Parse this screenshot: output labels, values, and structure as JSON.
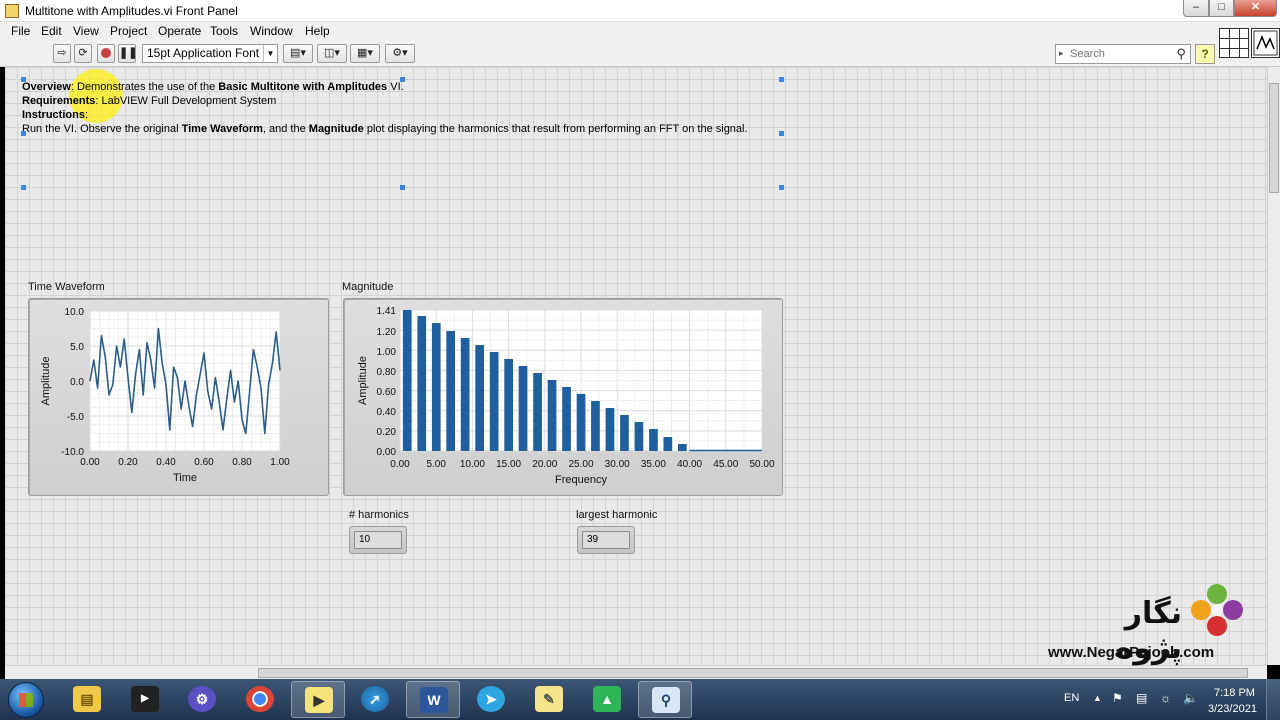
{
  "window": {
    "title": "Multitone with Amplitudes.vi Front Panel",
    "minimize": "–",
    "maximize": "□",
    "close": "✕"
  },
  "menu": [
    "File",
    "Edit",
    "View",
    "Project",
    "Operate",
    "Tools",
    "Window",
    "Help"
  ],
  "toolbar": {
    "font": "15pt Application Font",
    "search_placeholder": "Search",
    "help": "?"
  },
  "description": {
    "overview_label": "Overview",
    "overview_text": ": Demonstrates the use of the ",
    "overview_bold": "Basic Multitone with Amplitudes",
    "overview_end": " VI.",
    "requirements_label": "Requirements",
    "requirements_text": ": LabVIEW Full Development System",
    "instructions_label": "Instructions",
    "instructions_colon": ":",
    "run_1": "Run the VI. Observe the original ",
    "run_bold1": "Time Waveform",
    "run_2": ", and the ",
    "run_bold2": "Magnitude",
    "run_3": " plot displaying the harmonics that result from performing an FFT on the signal."
  },
  "indicators": {
    "harmonics_label": "# harmonics",
    "harmonics_value": "10",
    "largest_label": "largest harmonic",
    "largest_value": "39"
  },
  "watermark": {
    "brand_fa": "نگار پژوه",
    "url": "www.NegarPajooh.com"
  },
  "taskbar": {
    "language": "EN",
    "time": "7:18 PM",
    "date": "3/23/2021"
  },
  "colors": {
    "plot": "#2b5d8a",
    "bar": "#1f5f9e",
    "plot_bg": "#ffffff",
    "highlight": "#fff000"
  },
  "chart_data": [
    {
      "type": "line",
      "title": "Time Waveform",
      "xlabel": "Time",
      "ylabel": "Amplitude",
      "xlim": [
        0,
        1
      ],
      "ylim": [
        -10,
        10
      ],
      "xticks": [
        "0.00",
        "0.20",
        "0.40",
        "0.60",
        "0.80",
        "1.00"
      ],
      "yticks": [
        "10.0",
        "5.0",
        "0.0",
        "-5.0",
        "-10.0"
      ],
      "grid": true,
      "x": [
        0.0,
        0.02,
        0.04,
        0.06,
        0.08,
        0.1,
        0.12,
        0.14,
        0.16,
        0.18,
        0.2,
        0.22,
        0.24,
        0.26,
        0.28,
        0.3,
        0.32,
        0.34,
        0.36,
        0.38,
        0.4,
        0.42,
        0.44,
        0.46,
        0.48,
        0.5,
        0.52,
        0.54,
        0.56,
        0.58,
        0.6,
        0.62,
        0.64,
        0.66,
        0.68,
        0.7,
        0.72,
        0.74,
        0.76,
        0.78,
        0.8,
        0.82,
        0.84,
        0.86,
        0.88,
        0.9,
        0.92,
        0.94,
        0.96,
        0.98,
        1.0
      ],
      "y": [
        0.0,
        3.0,
        -1.0,
        6.5,
        3.5,
        -2.0,
        -0.5,
        5.0,
        2.0,
        6.0,
        0.5,
        -4.5,
        1.0,
        4.5,
        -2.0,
        5.5,
        3.0,
        -1.0,
        7.5,
        2.5,
        -0.5,
        -7.0,
        2.0,
        0.5,
        -4.0,
        0.0,
        -3.5,
        -6.5,
        -2.0,
        1.0,
        4.0,
        -1.5,
        -4.0,
        0.5,
        -3.0,
        -7.0,
        -2.5,
        1.5,
        -3.0,
        0.0,
        -5.5,
        -7.5,
        -1.5,
        4.5,
        2.0,
        -1.0,
        -7.5,
        -0.5,
        2.5,
        7.0,
        1.5
      ]
    },
    {
      "type": "bar",
      "title": "Magnitude",
      "xlabel": "Frequency",
      "ylabel": "Amplitude",
      "xlim": [
        0,
        50
      ],
      "ylim": [
        0,
        1.41
      ],
      "xticks": [
        "0.00",
        "5.00",
        "10.00",
        "15.00",
        "20.00",
        "25.00",
        "30.00",
        "35.00",
        "40.00",
        "45.00",
        "50.00"
      ],
      "yticks": [
        "1.41",
        "1.20",
        "1.00",
        "0.80",
        "0.60",
        "0.40",
        "0.20",
        "0.00"
      ],
      "grid": true,
      "x": [
        1,
        3,
        5,
        7,
        9,
        11,
        13,
        15,
        17,
        19,
        21,
        23,
        25,
        27,
        29,
        31,
        33,
        35,
        37,
        39
      ],
      "values": [
        1.41,
        1.35,
        1.28,
        1.2,
        1.13,
        1.06,
        0.99,
        0.92,
        0.85,
        0.78,
        0.71,
        0.64,
        0.57,
        0.5,
        0.43,
        0.36,
        0.29,
        0.22,
        0.14,
        0.07
      ]
    }
  ]
}
